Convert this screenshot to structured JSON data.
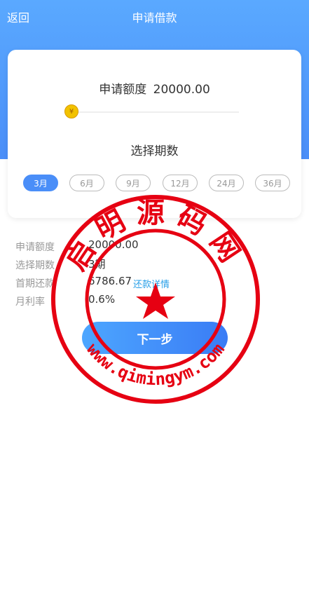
{
  "header": {
    "back": "返回",
    "title": "申请借款"
  },
  "card": {
    "amount_label": "申请额度",
    "amount_value": "20000.00",
    "slider_fraction": 0.0,
    "slider_thumb_symbol": "¥",
    "period_title": "选择期数",
    "periods": [
      "3月",
      "6月",
      "9月",
      "12月",
      "24月",
      "36月"
    ],
    "active_period": "3月"
  },
  "details": {
    "rows": [
      {
        "label": "申请额度",
        "value": "20000.00"
      },
      {
        "label": "选择期数",
        "value": "3期"
      },
      {
        "label": "首期还款",
        "value": "6786.67",
        "link": "还款详情"
      },
      {
        "label": "月利率",
        "value": "0.6%"
      }
    ]
  },
  "next_button": "下一步",
  "watermark": {
    "text": "启明源码网",
    "url": "www.qimingym.com",
    "color": "#e60012"
  },
  "colors": {
    "header_blue": "#4a8ef8",
    "accent": "#29a0e8"
  }
}
